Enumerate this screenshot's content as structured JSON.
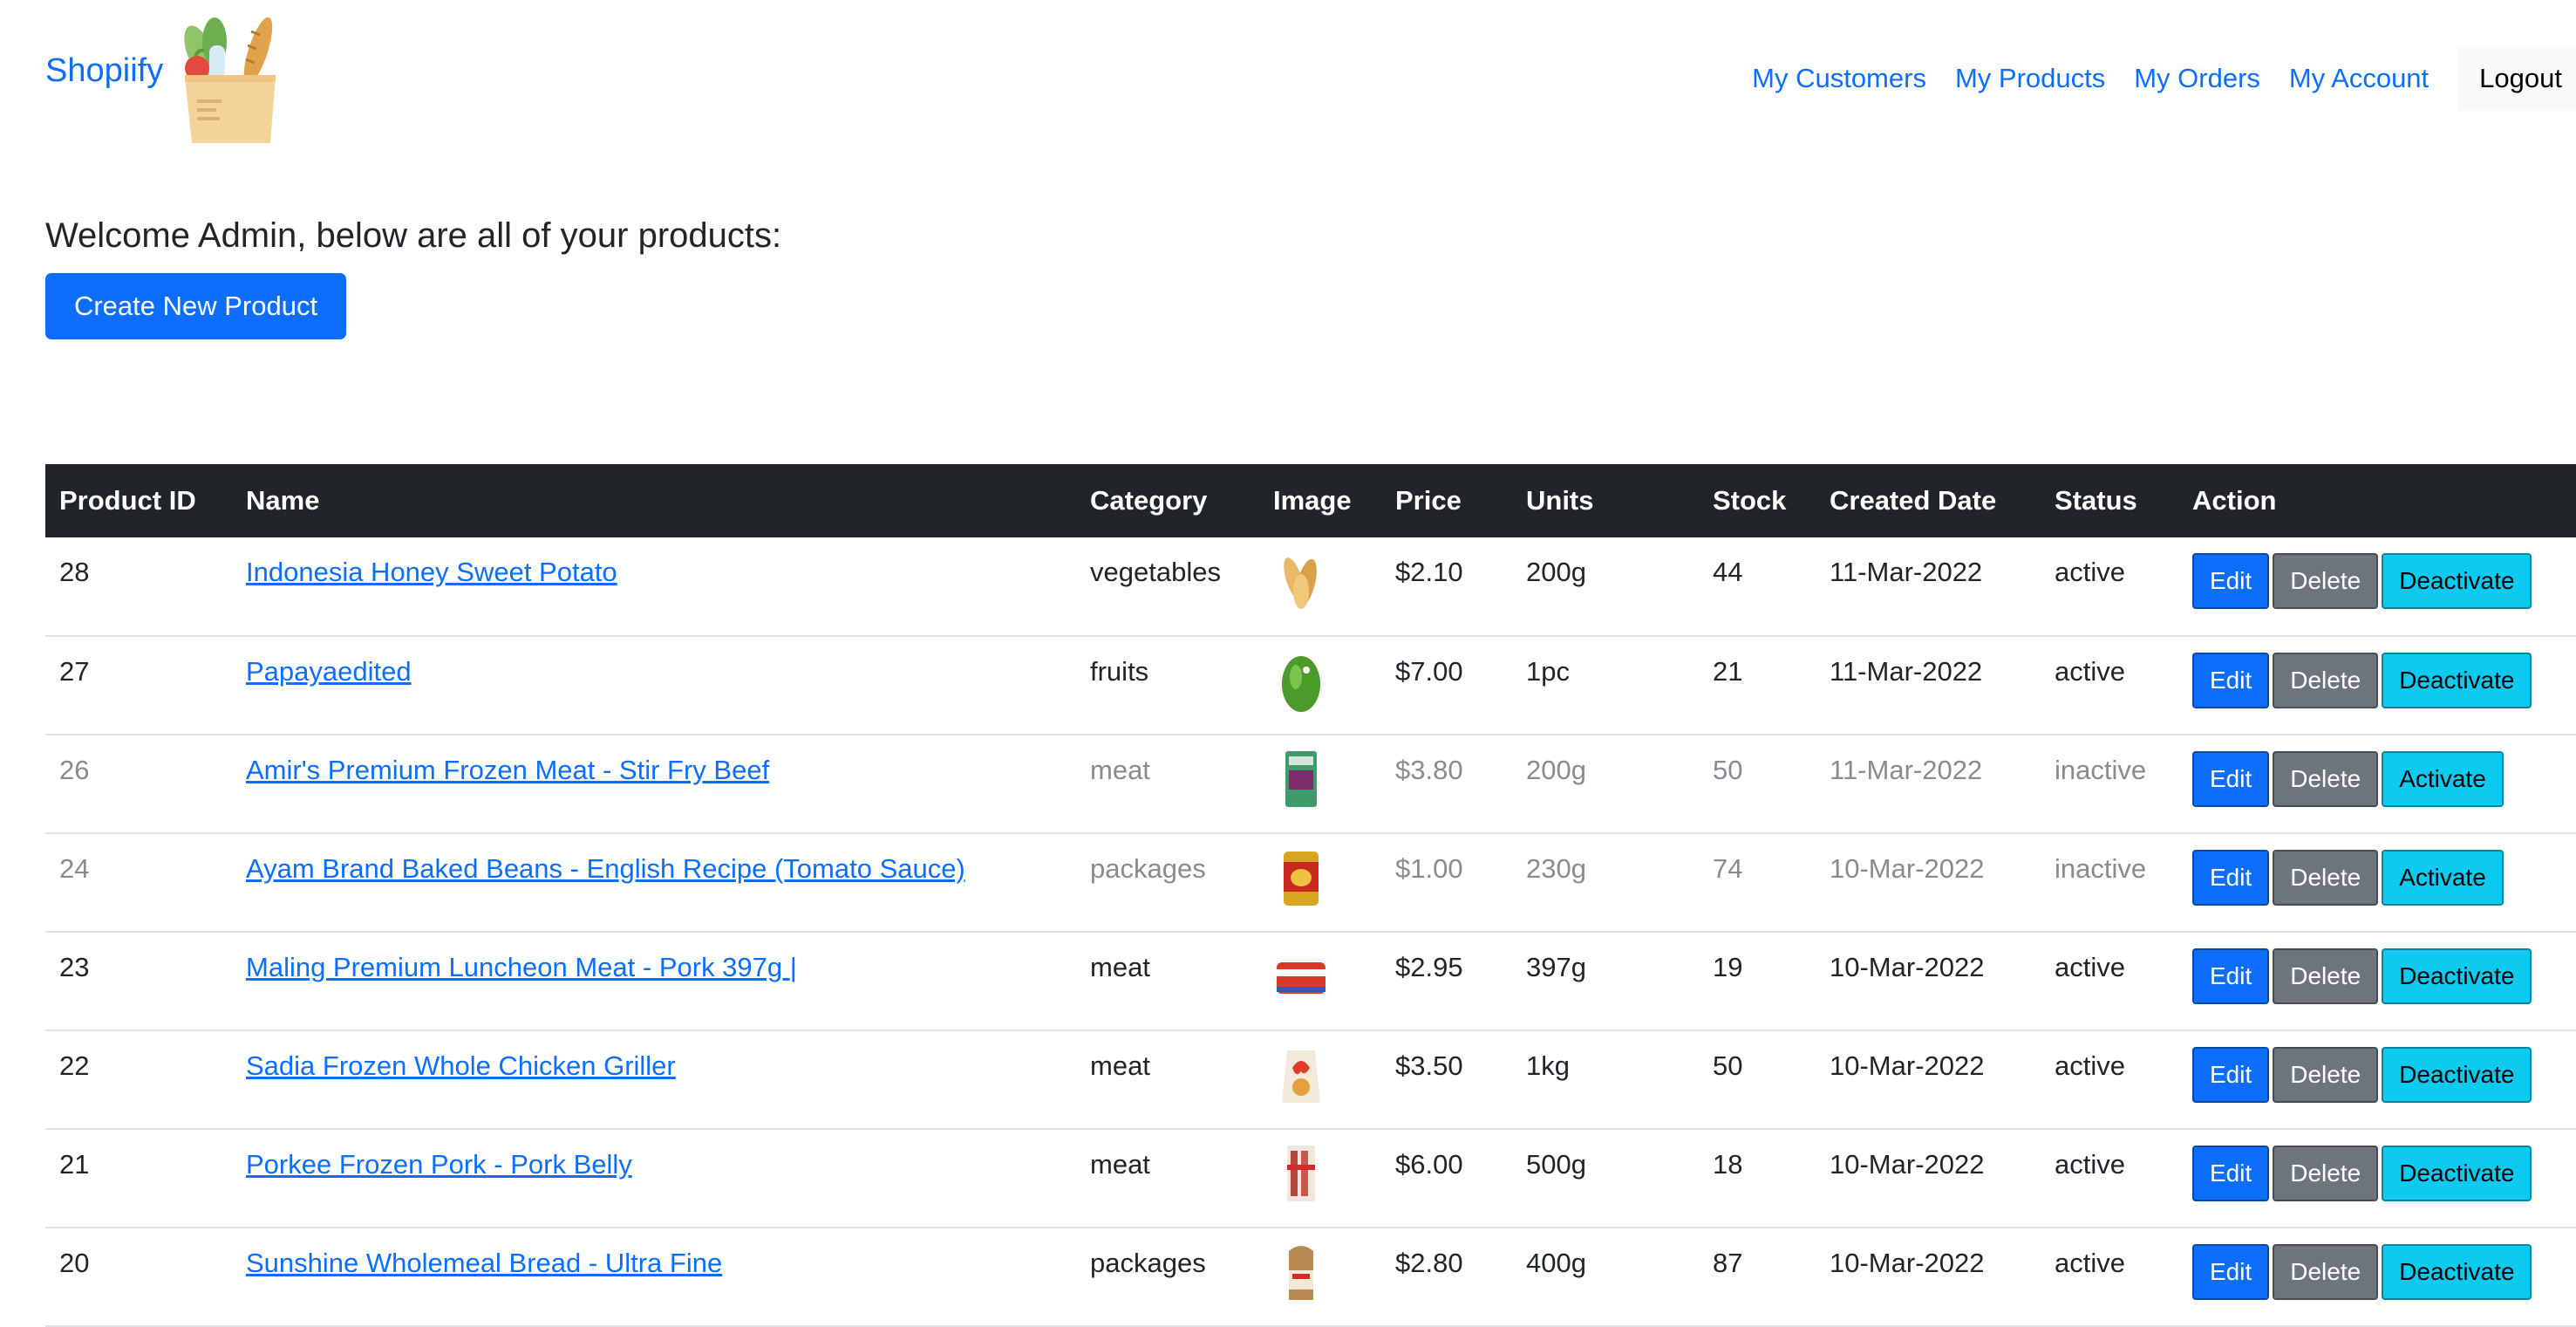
{
  "nav": {
    "brand": "Shopiify",
    "links": [
      "My Customers",
      "My Products",
      "My Orders",
      "My Account"
    ],
    "logout": "Logout"
  },
  "page": {
    "welcome": "Welcome Admin, below are all of your products:",
    "create_button": "Create New Product"
  },
  "table": {
    "headers": [
      "Product ID",
      "Name",
      "Category",
      "Image",
      "Price",
      "Units",
      "Stock",
      "Created Date",
      "Status",
      "Action"
    ],
    "rows": [
      {
        "id": "28",
        "name": "Indonesia Honey Sweet Potato",
        "category": "vegetables",
        "image": "sweet-potato",
        "price": "$2.10",
        "units": "200g",
        "stock": "44",
        "created": "11-Mar-2022",
        "status": "active",
        "toggle": "Deactivate"
      },
      {
        "id": "27",
        "name": "Papayaedited",
        "category": "fruits",
        "image": "papaya",
        "price": "$7.00",
        "units": "1pc",
        "stock": "21",
        "created": "11-Mar-2022",
        "status": "active",
        "toggle": "Deactivate"
      },
      {
        "id": "26",
        "name": "Amir's Premium Frozen Meat - Stir Fry Beef",
        "category": "meat",
        "image": "beef-pack",
        "price": "$3.80",
        "units": "200g",
        "stock": "50",
        "created": "11-Mar-2022",
        "status": "inactive",
        "toggle": "Activate"
      },
      {
        "id": "24",
        "name": "Ayam Brand Baked Beans - English Recipe (Tomato Sauce)",
        "category": "packages",
        "image": "bean-can",
        "price": "$1.00",
        "units": "230g",
        "stock": "74",
        "created": "10-Mar-2022",
        "status": "inactive",
        "toggle": "Activate"
      },
      {
        "id": "23",
        "name": "Maling Premium Luncheon Meat - Pork 397g |",
        "category": "meat",
        "image": "luncheon-can",
        "price": "$2.95",
        "units": "397g",
        "stock": "19",
        "created": "10-Mar-2022",
        "status": "active",
        "toggle": "Deactivate"
      },
      {
        "id": "22",
        "name": "Sadia Frozen Whole Chicken Griller",
        "category": "meat",
        "image": "chicken-bag",
        "price": "$3.50",
        "units": "1kg",
        "stock": "50",
        "created": "10-Mar-2022",
        "status": "active",
        "toggle": "Deactivate"
      },
      {
        "id": "21",
        "name": "Porkee Frozen Pork - Pork Belly",
        "category": "meat",
        "image": "pork-pack",
        "price": "$6.00",
        "units": "500g",
        "stock": "18",
        "created": "10-Mar-2022",
        "status": "active",
        "toggle": "Deactivate"
      },
      {
        "id": "20",
        "name": "Sunshine Wholemeal Bread - Ultra Fine",
        "category": "packages",
        "image": "bread-loaf",
        "price": "$2.80",
        "units": "400g",
        "stock": "87",
        "created": "10-Mar-2022",
        "status": "active",
        "toggle": "Deactivate"
      }
    ],
    "action_labels": {
      "edit": "Edit",
      "delete": "Delete"
    }
  }
}
